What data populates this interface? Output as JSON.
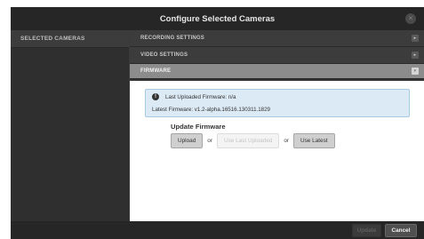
{
  "dialog": {
    "title": "Configure Selected Cameras",
    "close_glyph": "×"
  },
  "left_panel": {
    "header": "SELECTED CAMERAS"
  },
  "sections": [
    {
      "label": "RECORDING SETTINGS",
      "state": "collapsed",
      "arrow": "▸"
    },
    {
      "label": "VIDEO SETTINGS",
      "state": "collapsed",
      "arrow": "▸"
    },
    {
      "label": "FIRMWARE",
      "state": "expanded",
      "arrow": "▾"
    }
  ],
  "firmware": {
    "info_icon": "!",
    "last_uploaded": "Last Uploaded Firmware: n/a",
    "latest": "Latest Firmware: v1.2-alpha.16516.130311.1829",
    "update_heading": "Update Firmware",
    "upload_label": "Upload",
    "or_1": "or",
    "use_last_uploaded_label": "Use Last Uploaded",
    "or_2": "or",
    "use_latest_label": "Use Latest"
  },
  "footer": {
    "update_label": "Update",
    "cancel_label": "Cancel"
  },
  "colors": {
    "title_bar": "#262626",
    "active_section": "#8c8c8c",
    "info_box": "#dbeaf4"
  }
}
